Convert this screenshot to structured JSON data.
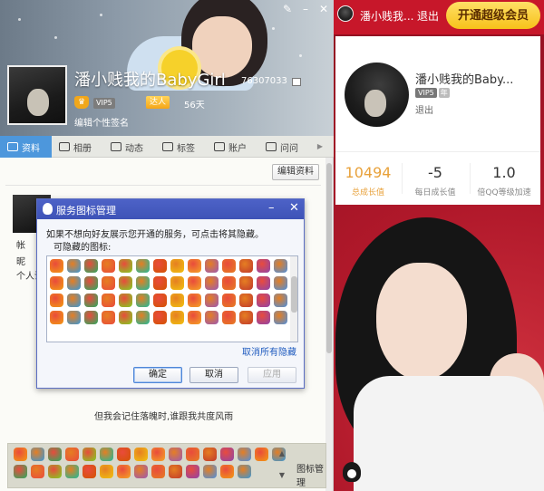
{
  "vip_page": {
    "username": "潘小贱我...",
    "logout_label": "退出",
    "open_vip_label": "开通超级会员",
    "card": {
      "name": "潘小贱我的Baby...",
      "vip_level": "VIP5",
      "badge_extra": "年",
      "logout_label": "退出",
      "stats": [
        {
          "value": "10494",
          "label": "总成长值",
          "color": "#e8a13a"
        },
        {
          "value": "-5",
          "label": "每日成长值"
        },
        {
          "value": "1.0",
          "label": "倍QQ等级加速"
        }
      ]
    }
  },
  "profile": {
    "nickname": "潘小贱我的BabyGirl",
    "qq_number": "76307033",
    "vip_level": "VIP5",
    "daren_label": "达人",
    "days": "56天",
    "signature_prompt": "编辑个性签名",
    "tabs": [
      {
        "label": "资料",
        "icon": "id-card-icon",
        "active": true
      },
      {
        "label": "相册",
        "icon": "photo-icon"
      },
      {
        "label": "动态",
        "icon": "feed-icon"
      },
      {
        "label": "标签",
        "icon": "tag-icon"
      },
      {
        "label": "账户",
        "icon": "account-icon"
      },
      {
        "label": "问问",
        "icon": "question-icon"
      }
    ],
    "edit_button": "编辑资料",
    "info_labels": [
      "帐",
      "昵",
      "个人说"
    ],
    "quote": "但我会记住落魄时,谁跟我共度风雨",
    "icon_bar_label": "图标管理"
  },
  "dialog": {
    "title": "服务图标管理",
    "description": "如果不想向好友展示您开通的服务，可点击将其隐藏。",
    "sub_label": "可隐藏的图标:",
    "cancel_all_label": "取消所有隐藏",
    "ok_label": "确定",
    "cancel_label": "取消",
    "apply_label": "应用"
  }
}
